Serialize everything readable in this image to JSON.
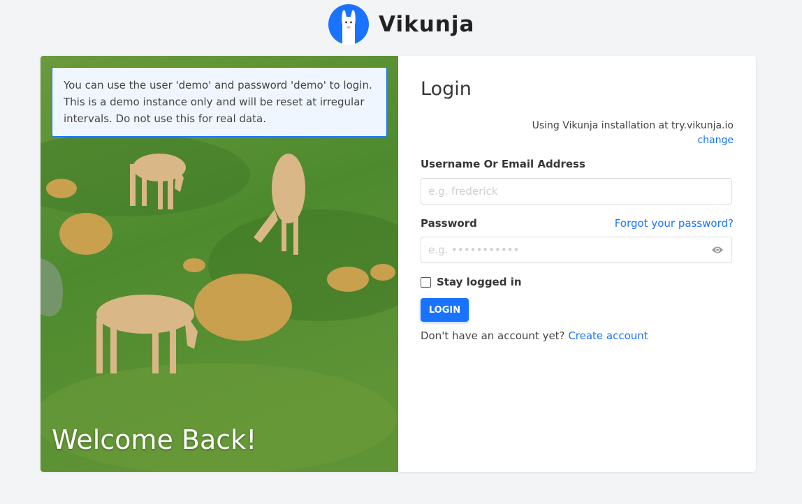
{
  "brand": {
    "name": "Vikunja"
  },
  "hero": {
    "demo_notice": "You can use the user 'demo' and password 'demo' to login. This is a demo instance only and will be reset at irregular intervals. Do not use this for real data.",
    "welcome": "Welcome Back!"
  },
  "login": {
    "title": "Login",
    "install_text": "Using Vikunja installation at try.vikunja.io",
    "change_link": "change",
    "username_label": "Username Or Email Address",
    "username_placeholder": "e.g. frederick",
    "password_label": "Password",
    "password_placeholder": "e.g. •••••••••••",
    "forgot_link": "Forgot your password?",
    "stay_logged_in": "Stay logged in",
    "login_button": "LOGIN",
    "no_account_text": "Don't have an account yet?",
    "create_account_link": "Create account"
  },
  "icons": {
    "logo": "llama-logo-icon",
    "password_toggle": "eye-icon"
  },
  "colors": {
    "accent": "#1973ff",
    "background": "#f3f4f6"
  }
}
